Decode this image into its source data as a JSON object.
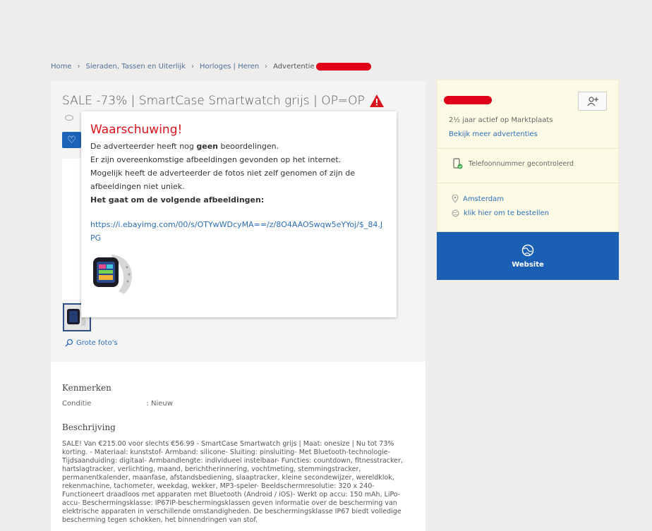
{
  "breadcrumb": {
    "home": "Home",
    "category": "Sieraden, Tassen en Uiterlijk",
    "subcategory": "Horloges | Heren",
    "current": "Advertentie"
  },
  "listing": {
    "title": "SALE -73% | SmartCase Smartwatch grijs | OP=OP",
    "large_photos": "Grote foto's"
  },
  "warning": {
    "heading": "Waarschuwing!",
    "line1_pre": "De adverteerder heeft nog ",
    "line1_bold": "geen",
    "line1_post": " beoordelingen.",
    "line2": "Er zijn overeenkomstige afbeeldingen gevonden op het internet.",
    "line3": "Mogelijk heeft de adverteerder de fotos niet zelf genomen of zijn de afbeeldingen niet uniek.",
    "line4": "Het gaat om de volgende afbeeldingen:",
    "image_url": "https://i.ebayimg.com/00/s/OTYwWDcyMA==/z/8O4AAOSwqw5eYYoj/$_84.JPG"
  },
  "specs": {
    "heading": "Kenmerken",
    "condition_label": "Conditie",
    "condition_value": ": Nieuw"
  },
  "description": {
    "heading": "Beschrijving",
    "text": "SALE! Van €215.00 voor slechts €56.99 - SmartCase Smartwatch grijs | Maat: onesize | Nu tot 73% korting. - Materiaal: kunststof- Armband: silicone- Sluiting: pinsluiting- Met Bluetooth-technologie- Tijdsaanduiding: digitaal- Armbandlengte: individueel instelbaar- Functies: countdown, fitnesstracker, hartslagtracker, verlichting, maand, berichtherinnering, vochtmeting, stemmingstracker, permanentkalender, maanfase, afstandsbediening, slaaptracker, kleine secondewijzer, wereldklok, rekenmachine, tachometer, weekdag, wekker, MP3-speler- Beeldschermresolutie: 320 x 240- Functioneert draadloos met apparaten met Bluetooth (Android / iOS)- Werkt op accu: 150 mAh, LiPo-accu- Beschermingsklasse: IP67IP-beschermingsklassen geven informatie over de bescherming van elektrische apparaten in verschillende omstandigheden. De beschermingsklasse IP67 biedt volledige bescherming tegen schokken, het binnendringen van stof."
  },
  "seller": {
    "active": "2½ jaar actief op Marktplaats",
    "more_ads": "Bekijk meer advertenties",
    "phone": "Telefoonnummer gecontroleerd",
    "location": "Amsterdam",
    "order": "klik hier om te bestellen"
  },
  "website_button": {
    "label": "Website"
  },
  "colors": {
    "accent_blue": "#1a5fb4",
    "warning_red": "#d8131b",
    "seller_bg": "#fdfbe6"
  }
}
